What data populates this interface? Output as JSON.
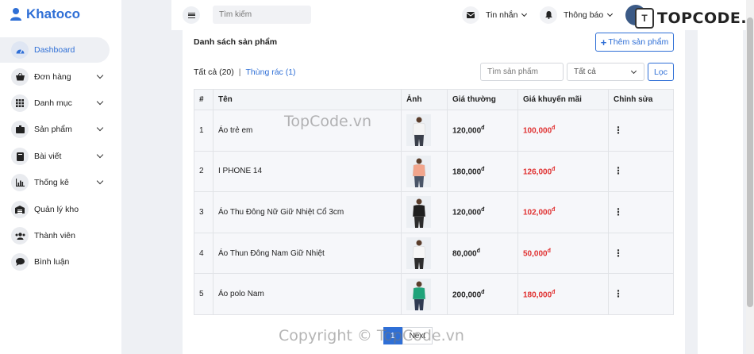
{
  "brand": {
    "name": "Khatoco"
  },
  "sidebar": {
    "items": [
      {
        "label": "Dashboard",
        "icon": "gauge-icon",
        "active": true,
        "has_children": false
      },
      {
        "label": "Đơn hàng",
        "icon": "basket-icon",
        "active": false,
        "has_children": true
      },
      {
        "label": "Danh mục",
        "icon": "grid-icon",
        "active": false,
        "has_children": true
      },
      {
        "label": "Sản phẩm",
        "icon": "box-icon",
        "active": false,
        "has_children": true
      },
      {
        "label": "Bài viết",
        "icon": "book-icon",
        "active": false,
        "has_children": true
      },
      {
        "label": "Thống kê",
        "icon": "chart-icon",
        "active": false,
        "has_children": true
      },
      {
        "label": "Quản lý kho",
        "icon": "warehouse-icon",
        "active": false,
        "has_children": false
      },
      {
        "label": "Thành viên",
        "icon": "users-icon",
        "active": false,
        "has_children": false
      },
      {
        "label": "Bình luận",
        "icon": "comment-icon",
        "active": false,
        "has_children": false
      }
    ]
  },
  "topbar": {
    "search_placeholder": "Tìm kiếm",
    "messages_label": "Tin nhắn",
    "notifications_label": "Thông báo"
  },
  "watermark": {
    "logo_text": "TOPCODE.VN",
    "center_text_1": "TopCode.vn",
    "center_text_2": "Copyright © TopCode.vn"
  },
  "main": {
    "title": "Danh sách sản phẩm",
    "add_button": "Thêm sản phẩm",
    "tab_all": "Tất cả (20)",
    "tab_separator": "|",
    "tab_trash": "Thùng rác (1)",
    "search_placeholder": "Tìm sản phẩm",
    "filter_select_value": "Tất cả",
    "filter_button": "Lọc",
    "table": {
      "headers": [
        "#",
        "Tên",
        "Ảnh",
        "Giá thường",
        "Giá khuyến mãi",
        "Chỉnh sửa"
      ],
      "rows": [
        {
          "index": "1",
          "name": "Áo trẻ em",
          "regular": "120,000",
          "sale": "100,000",
          "shirt_color": "#f4f4f4",
          "pants_color": "#3a3f4a"
        },
        {
          "index": "2",
          "name": "I PHONE 14",
          "regular": "180,000",
          "sale": "126,000",
          "shirt_color": "#f2a58c",
          "pants_color": "#4a5568"
        },
        {
          "index": "3",
          "name": "Áo Thu Đông Nữ Giữ Nhiệt Cổ 3cm",
          "regular": "120,000",
          "sale": "102,000",
          "shirt_color": "#1f1f1f",
          "pants_color": "#2b2b2b"
        },
        {
          "index": "4",
          "name": "Áo Thun Đông Nam Giữ Nhiệt",
          "regular": "80,000",
          "sale": "50,000",
          "shirt_color": "#f7f7f7",
          "pants_color": "#2d2d2d"
        },
        {
          "index": "5",
          "name": "Áo polo Nam",
          "regular": "200,000",
          "sale": "180,000",
          "shirt_color": "#1fa37a",
          "pants_color": "#2f3a52"
        }
      ],
      "currency": "đ",
      "edit_glyph": "⋮"
    },
    "pager": {
      "current": "1",
      "next_label": "Next"
    }
  }
}
